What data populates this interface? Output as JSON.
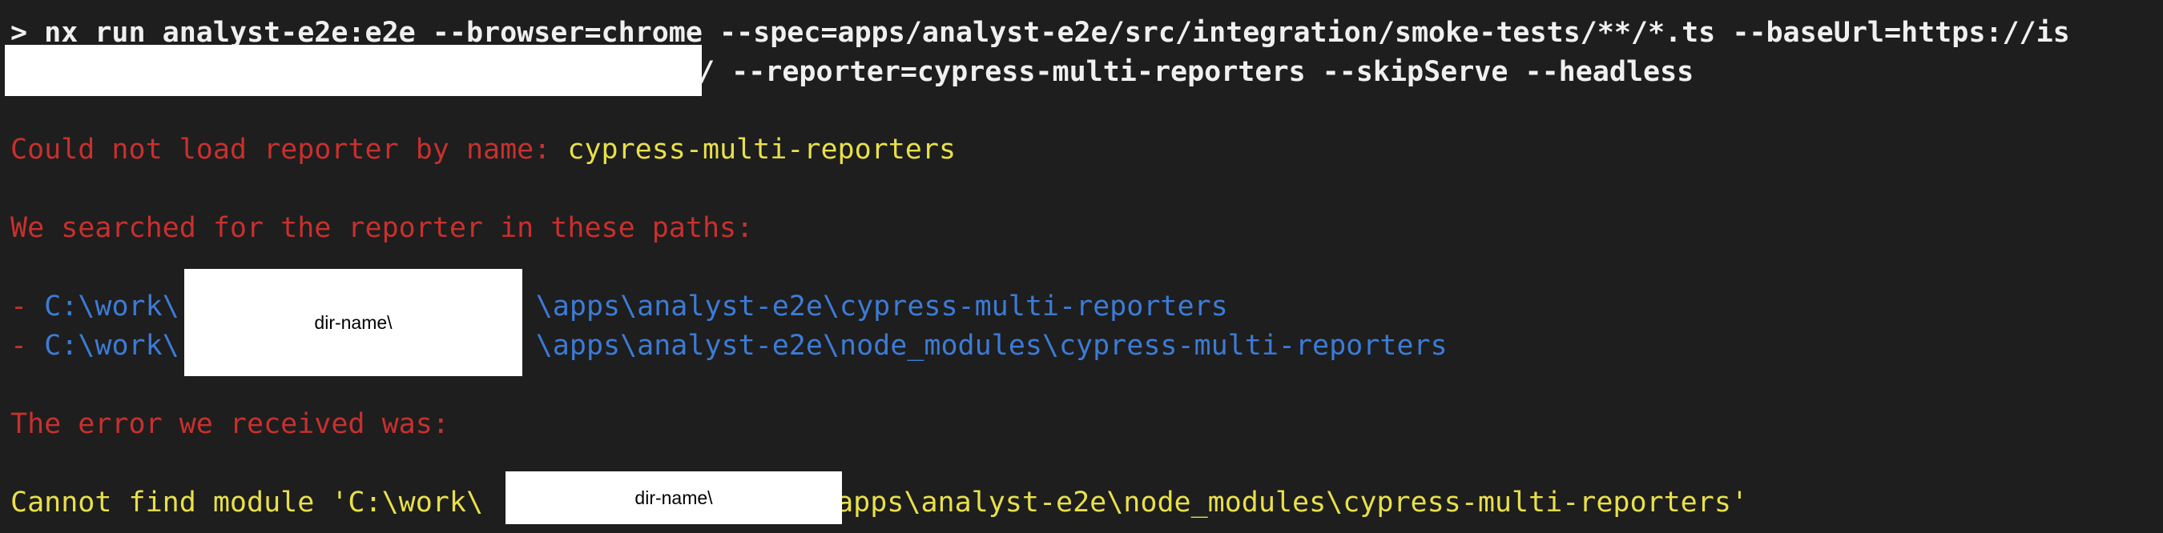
{
  "terminal": {
    "command_line_1": "> nx run analyst-e2e:e2e --browser=chrome --spec=apps/analyst-e2e/src/integration/smoke-tests/**/*.ts --baseUrl=https://is",
    "command_line_2": "/ --reporter=cypress-multi-reporters --skipServe --headless",
    "error_prefix": "Could not load reporter by name: ",
    "reporter_name": "cypress-multi-reporters",
    "searched_message": "We searched for the reporter in these paths:",
    "path_bullet": "- ",
    "path_1_start": "C:\\work\\",
    "path_1_end": "\\apps\\analyst-e2e\\cypress-multi-reporters",
    "path_2_start": "C:\\work\\",
    "path_2_end": "\\apps\\analyst-e2e\\node_modules\\cypress-multi-reporters",
    "received_message": "The error we received was:",
    "cannot_find_start": "Cannot find module 'C:\\work\\",
    "cannot_find_end": "\\apps\\analyst-e2e\\node_modules\\cypress-multi-reporters'",
    "redaction_label": "dir-name\\"
  },
  "colors": {
    "background": "#1e1e1e",
    "command_text": "#f0f0f0",
    "error_red": "#c8302e",
    "highlight_yellow": "#e8e04a",
    "path_blue": "#3c7bd6",
    "redaction_box": "#ffffff"
  }
}
